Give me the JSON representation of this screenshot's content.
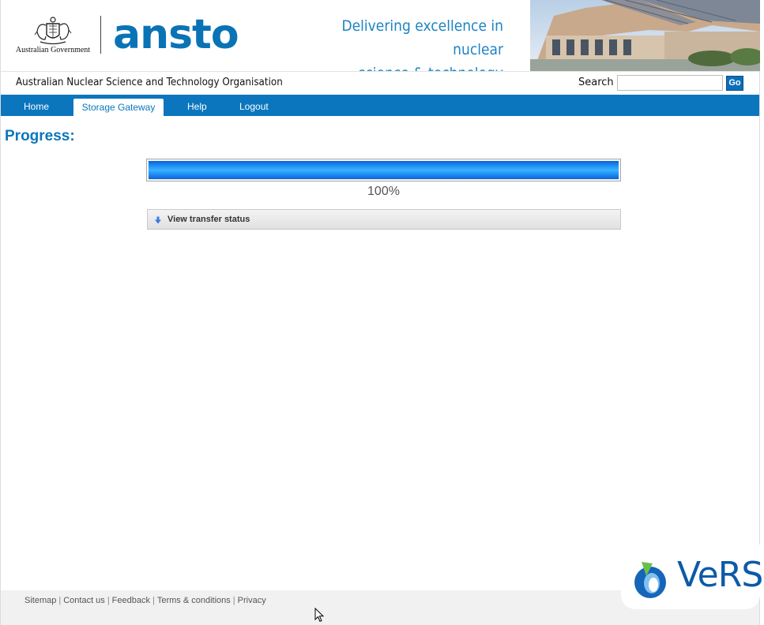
{
  "header": {
    "gov_text": "Australian Government",
    "logo_text": "ansto",
    "tagline_line1": "Delivering excellence in nuclear",
    "tagline_line2": "science & technology"
  },
  "subheader": {
    "org_name": "Australian Nuclear Science and Technology Organisation",
    "search_label": "Search",
    "search_value": "",
    "search_button": "Go"
  },
  "nav": {
    "items": [
      {
        "label": "Home"
      },
      {
        "label": "Storage Gateway",
        "active": true
      },
      {
        "label": "Help"
      },
      {
        "label": "Logout"
      }
    ]
  },
  "main": {
    "title": "Progress:",
    "progress_percent": 100,
    "progress_label": "100%",
    "transfer_toggle_label": "View transfer status"
  },
  "footer": {
    "links": [
      "Sitemap",
      "Contact us",
      "Feedback",
      "Terms & conditions",
      "Privacy"
    ],
    "partner_logo": "VeRSI"
  },
  "colors": {
    "brand_blue": "#0b76bd",
    "progress_fill": "#1e8cf3",
    "versi_blue": "#0d5aa7",
    "versi_green": "#7cc242"
  },
  "icons": {
    "toggle": "arrow-down-icon",
    "crest": "coat-of-arms-icon"
  }
}
